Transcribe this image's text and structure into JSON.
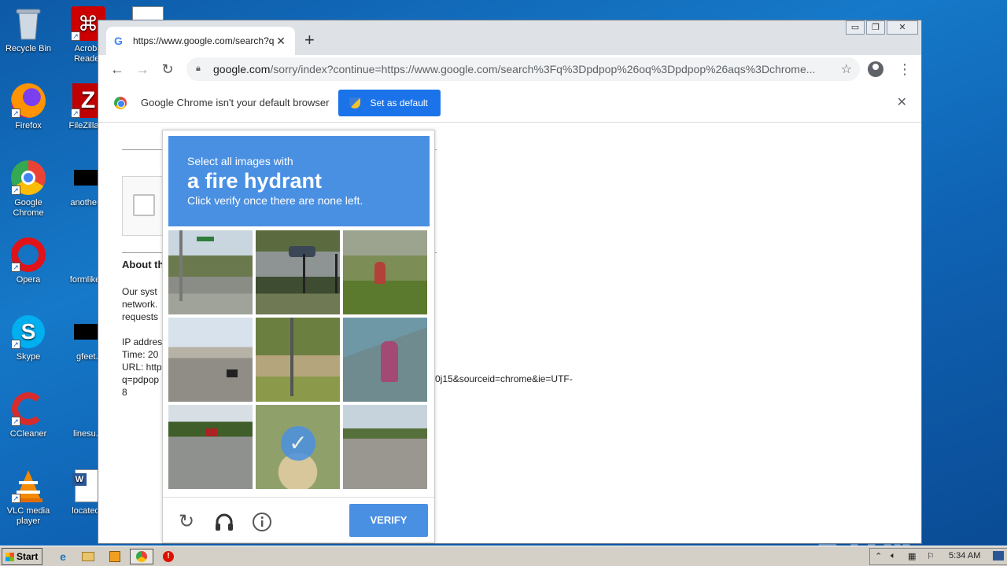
{
  "desktop": {
    "icons": [
      {
        "label": "Recycle Bin"
      },
      {
        "label": "Acroba Reader"
      },
      {
        "label": "Firefox"
      },
      {
        "label": "FileZilla C"
      },
      {
        "label": "Google Chrome"
      },
      {
        "label": "anotherw"
      },
      {
        "label": "Opera"
      },
      {
        "label": "formlikely"
      },
      {
        "label": "Skype"
      },
      {
        "label": "gfeet.j"
      },
      {
        "label": "CCleaner"
      },
      {
        "label": "linesu.p"
      },
      {
        "label": "VLC media player"
      },
      {
        "label": "locatede"
      }
    ],
    "watermark": "ANY RUN"
  },
  "browser": {
    "tab_title": "https://www.google.com/search?q=",
    "tab_close": "✕",
    "new_tab": "+",
    "window_controls": {
      "minimize": "▭",
      "restore": "❐",
      "close": "✕"
    },
    "nav": {
      "back": "←",
      "forward": "→",
      "reload": "↻"
    },
    "url_host": "google.com",
    "url_rest": "/sorry/index?continue=https://www.google.com/search%3Fq%3Dpdpop%26oq%3Dpdpop%26aqs%3Dchrome...",
    "star": "☆",
    "menu": "⋮",
    "infobar_text": "Google Chrome isn't your default browser",
    "set_default_label": "Set as default",
    "infobar_close": "✕"
  },
  "page": {
    "about_heading": "About th",
    "paragraph_lines": [
      "Our syst",
      "network.",
      "requests"
    ],
    "meta_lines": [
      "IP addres",
      "Time: 20",
      "URL: http",
      "q=pdpop",
      "8"
    ],
    "url_tail": "0j15&sourceid=chrome&ie=UTF-"
  },
  "captcha": {
    "line1": "Select all images with",
    "target": "a fire hydrant",
    "line3": "Click verify once there are none left.",
    "verify_label": "VERIFY",
    "tiles": [
      {
        "subject": "street-trees",
        "selected": false
      },
      {
        "subject": "street-railing",
        "selected": false
      },
      {
        "subject": "fire-hydrant-grass",
        "selected": false
      },
      {
        "subject": "overpass-road",
        "selected": false
      },
      {
        "subject": "palm-trees",
        "selected": false
      },
      {
        "subject": "fire-hydrant-sidewalk",
        "selected": false
      },
      {
        "subject": "road-car",
        "selected": false
      },
      {
        "subject": "fire-hydrant-closeup",
        "selected": true
      },
      {
        "subject": "street-intersection",
        "selected": false
      }
    ],
    "colors": {
      "header": "#4a90e2",
      "verify": "#4a90e2"
    }
  },
  "taskbar": {
    "start_label": "Start",
    "clock": "5:34 AM"
  }
}
